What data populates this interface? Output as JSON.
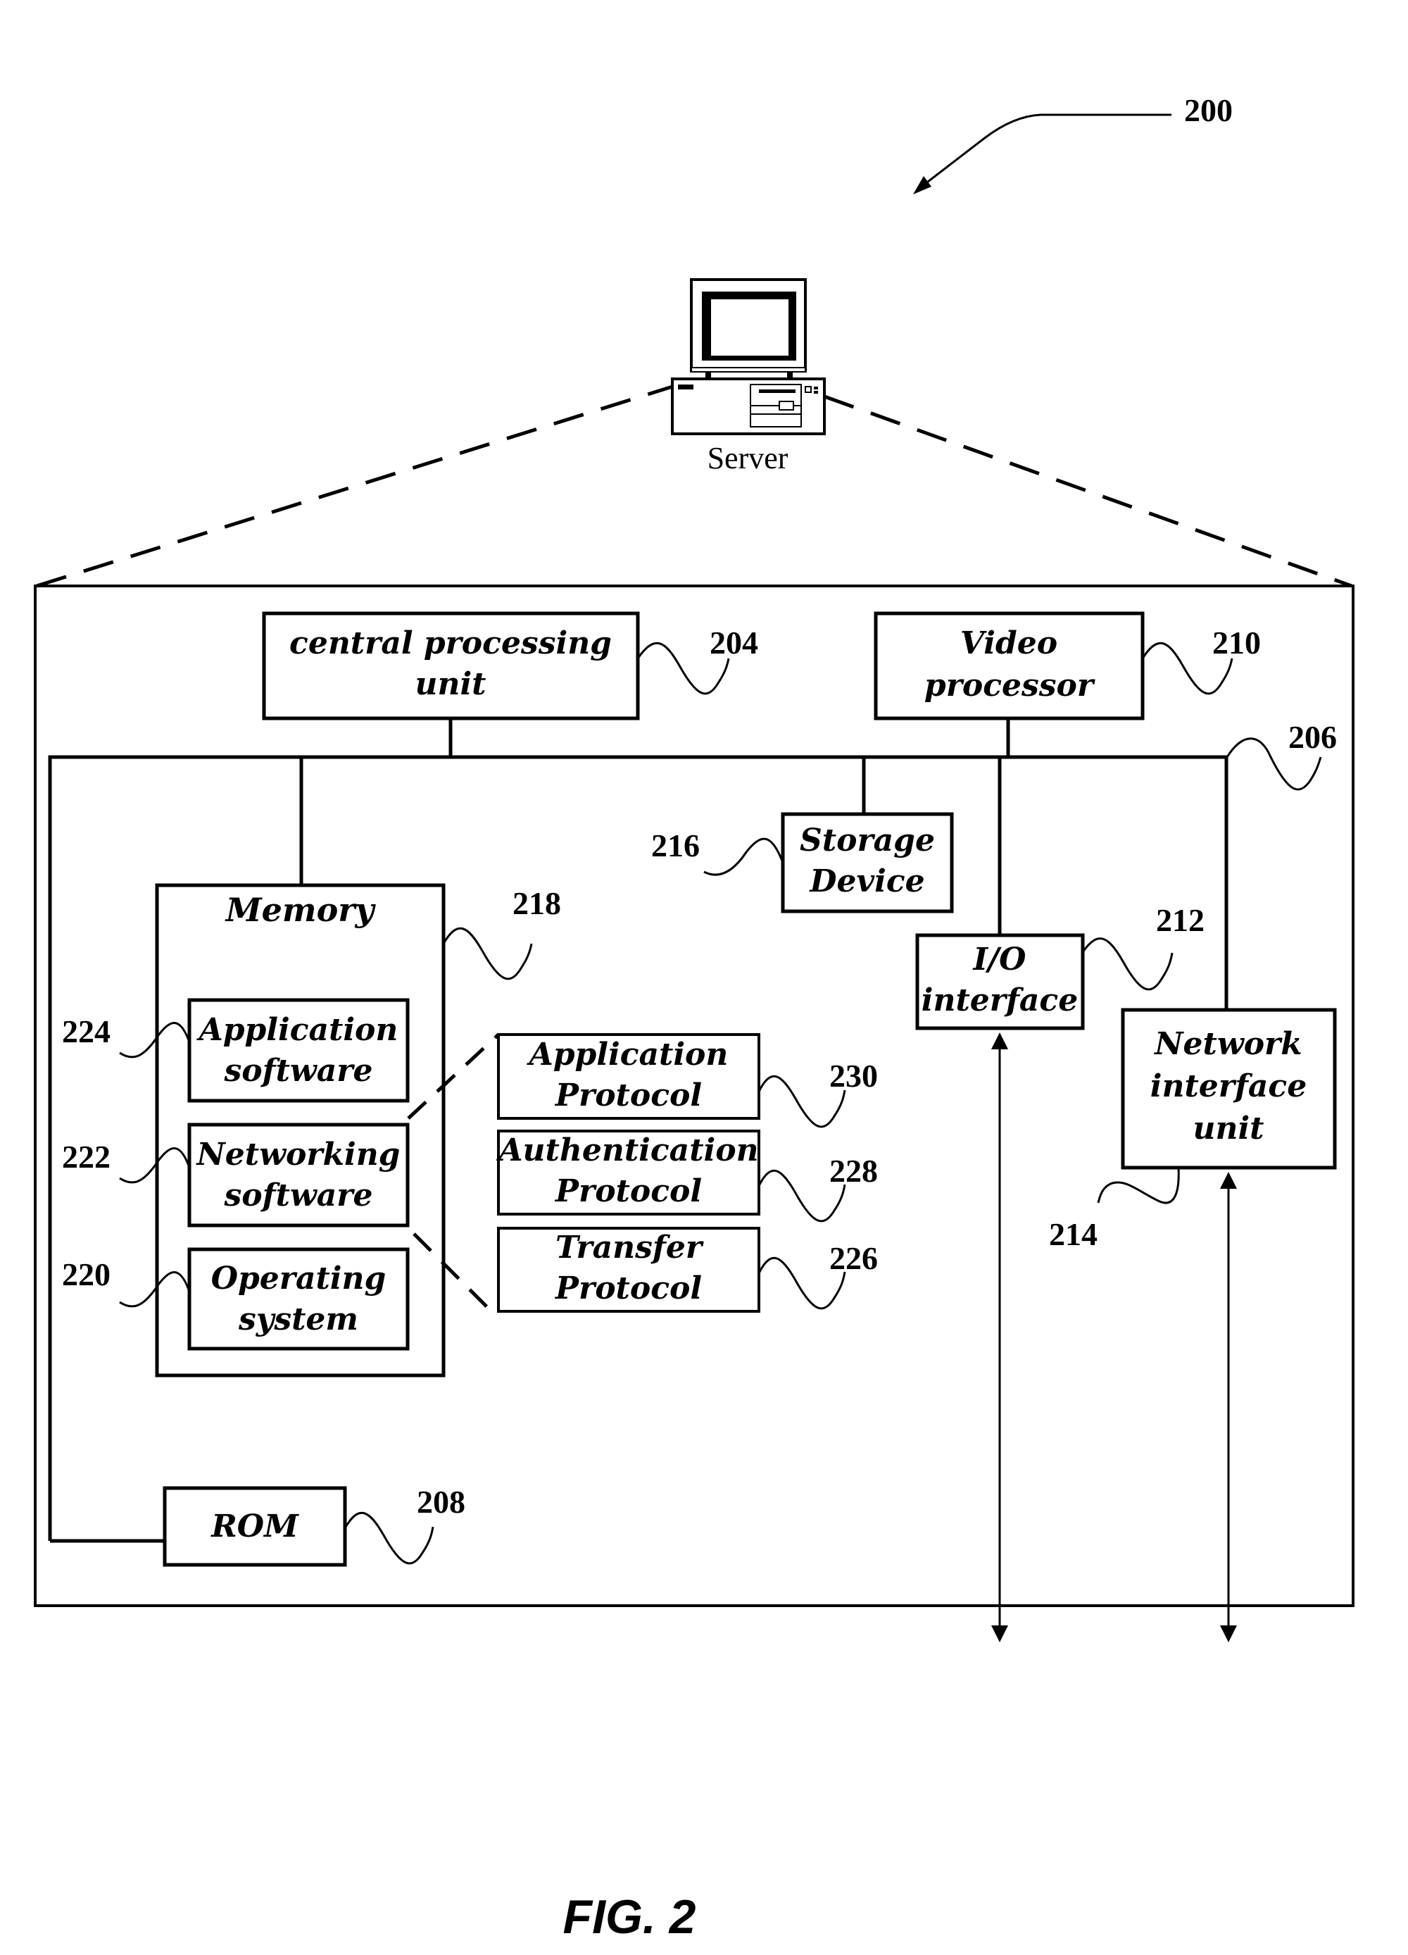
{
  "figure": {
    "caption": "FIG. 2",
    "reference": "200"
  },
  "server": {
    "label": "Server",
    "icon": "desktop-computer-icon"
  },
  "components": {
    "cpu": {
      "line1": "central processing",
      "line2": "unit",
      "ref": "204"
    },
    "video": {
      "line1": "Video",
      "line2": "processor",
      "ref": "210"
    },
    "bus": {
      "ref": "206"
    },
    "storage": {
      "line1": "Storage",
      "line2": "Device",
      "ref": "216"
    },
    "memory": {
      "label": "Memory",
      "ref": "218"
    },
    "app_software": {
      "line1": "Application",
      "line2": "software",
      "ref": "224"
    },
    "net_software": {
      "line1": "Networking",
      "line2": "software",
      "ref": "222"
    },
    "os": {
      "line1": "Operating",
      "line2": "system",
      "ref": "220"
    },
    "app_protocol": {
      "line1": "Application",
      "line2": "Protocol",
      "ref": "230"
    },
    "auth_protocol": {
      "line1": "Authentication",
      "line2": "Protocol",
      "ref": "228"
    },
    "transfer_protocol": {
      "line1": "Transfer",
      "line2": "Protocol",
      "ref": "226"
    },
    "io": {
      "line1": "I/O",
      "line2": "interface",
      "ref": "212"
    },
    "niu": {
      "line1": "Network",
      "line2": "interface",
      "line3": "unit",
      "ref": "214"
    },
    "rom": {
      "label": "ROM",
      "ref": "208"
    }
  }
}
